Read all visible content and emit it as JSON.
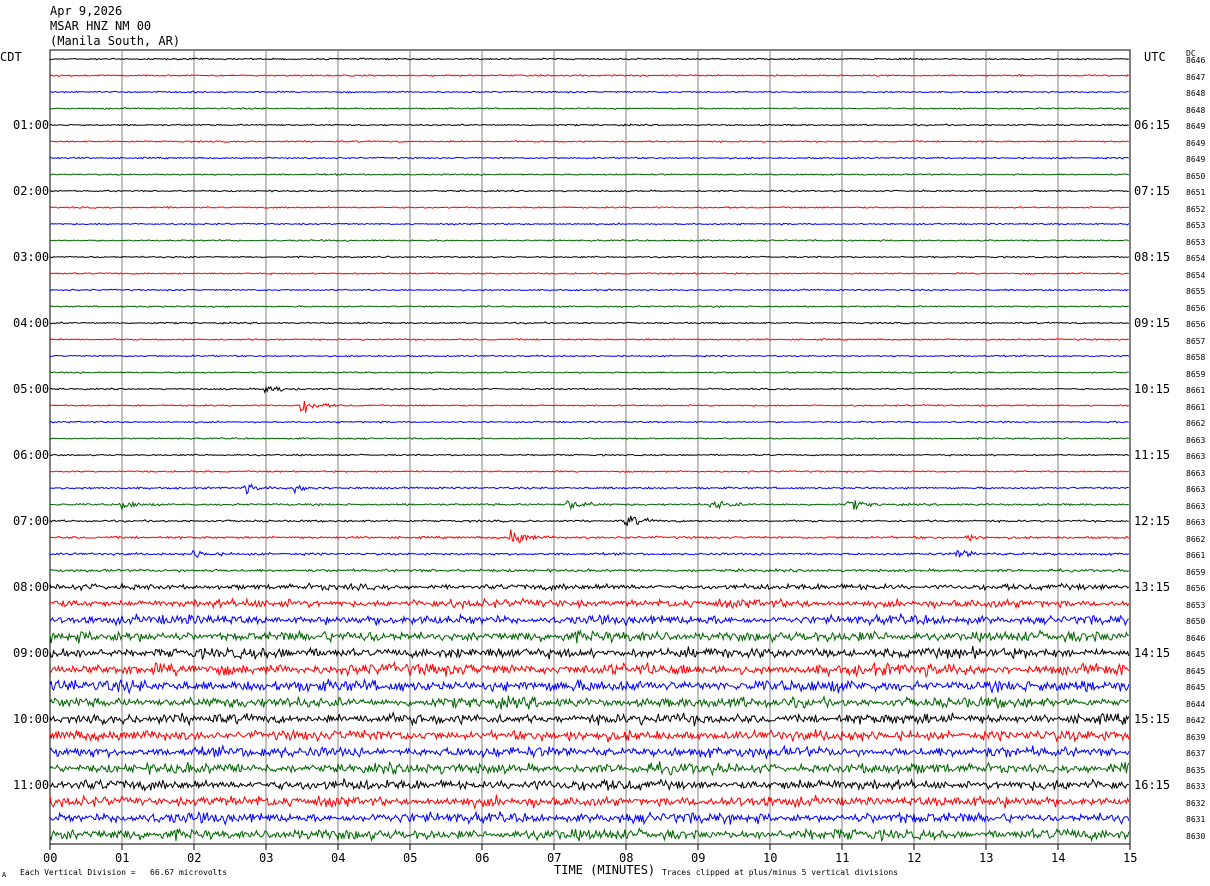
{
  "header": {
    "date": "Apr 9,2026",
    "station": "MSAR HNZ NM 00",
    "location": "(Manila South, AR)"
  },
  "left_zone": "CDT",
  "right_zone": "UTC",
  "dc_header": "DC",
  "left_hour_labels": [
    "01:00",
    "02:00",
    "03:00",
    "04:00",
    "05:00",
    "06:00",
    "07:00",
    "08:00",
    "09:00",
    "10:00",
    "11:00"
  ],
  "right_hour_labels": [
    "06:15",
    "07:15",
    "08:15",
    "09:15",
    "10:15",
    "11:15",
    "12:15",
    "13:15",
    "14:15",
    "15:15",
    "16:15"
  ],
  "dc_values": [
    "8646",
    "8647",
    "8648",
    "8648",
    "8649",
    "8649",
    "8649",
    "8650",
    "8651",
    "8652",
    "8653",
    "8653",
    "8654",
    "8654",
    "8655",
    "8656",
    "8656",
    "8657",
    "8658",
    "8659",
    "8661",
    "8661",
    "8662",
    "8663",
    "8663",
    "8663",
    "8663",
    "8663",
    "8663",
    "8662",
    "8661",
    "8659",
    "8656",
    "8653",
    "8650",
    "8646",
    "8645",
    "8645",
    "8645",
    "8644",
    "8642",
    "8639",
    "8637",
    "8635",
    "8633",
    "8632",
    "8631",
    "8630"
  ],
  "footer": {
    "xlabel": "TIME (MINUTES)",
    "scale_note": "Each Vertical Division =   66.67 microvolts",
    "clip_note": "Traces clipped at plus/minus 5 vertical divisions",
    "corner_mark": "A"
  },
  "chart_data": {
    "type": "line",
    "title": "MSAR HNZ NM 00",
    "xlabel": "TIME (MINUTES)",
    "x_tick_labels": [
      "00",
      "01",
      "02",
      "03",
      "04",
      "05",
      "06",
      "07",
      "08",
      "09",
      "10",
      "11",
      "12",
      "13",
      "14",
      "15"
    ],
    "xlim": [
      0,
      15
    ],
    "trace_count": 48,
    "minutes_per_trace": 15,
    "trace_colors": [
      "#000000",
      "#ff0000",
      "#0000ff",
      "#006400"
    ],
    "grid": true,
    "trace_noise_levels": [
      1,
      1,
      1,
      1,
      1,
      1,
      1,
      1,
      1,
      1,
      1,
      1,
      1,
      1,
      1,
      1,
      1,
      1,
      1,
      1,
      1,
      1,
      1,
      1,
      1,
      1,
      1.3,
      1.3,
      1.3,
      1.5,
      1.5,
      1.8,
      2.5,
      3.5,
      4,
      4.5,
      4.5,
      5,
      5,
      4.5,
      4.5,
      4.5,
      4.5,
      4.5,
      4.5,
      4.5,
      4.5,
      4.5
    ],
    "events": [
      {
        "trace": 20,
        "minute": 3.0,
        "amplitude": 5
      },
      {
        "trace": 21,
        "minute": 3.5,
        "amplitude": 7
      },
      {
        "trace": 26,
        "minute": 2.7,
        "amplitude": 4
      },
      {
        "trace": 26,
        "minute": 3.4,
        "amplitude": 4
      },
      {
        "trace": 27,
        "minute": 1.0,
        "amplitude": 4
      },
      {
        "trace": 27,
        "minute": 7.2,
        "amplitude": 6
      },
      {
        "trace": 27,
        "minute": 9.2,
        "amplitude": 5
      },
      {
        "trace": 27,
        "minute": 11.1,
        "amplitude": 5
      },
      {
        "trace": 28,
        "minute": 8.0,
        "amplitude": 6
      },
      {
        "trace": 29,
        "minute": 6.4,
        "amplitude": 9
      },
      {
        "trace": 29,
        "minute": 12.7,
        "amplitude": 3
      },
      {
        "trace": 30,
        "minute": 2.0,
        "amplitude": 4
      },
      {
        "trace": 30,
        "minute": 12.6,
        "amplitude": 5
      }
    ]
  }
}
